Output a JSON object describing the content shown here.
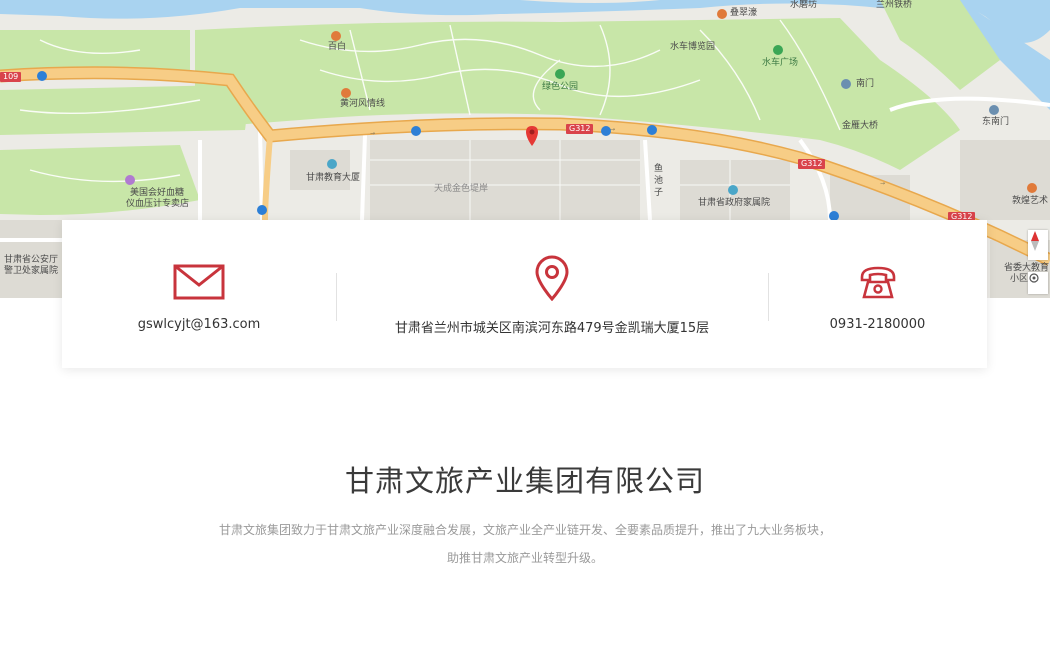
{
  "map": {
    "labels": {
      "dieci": "叠翠濠",
      "shuimo": "水磨坊",
      "lanzhou_bridge": "兰州铁桥",
      "baita": "百白",
      "shuiche_museum": "水车博览园",
      "shuiche_square": "水车广场",
      "lvse_park": "绿色公园",
      "nanmen": "南门",
      "huanghe_line": "黄河风情线",
      "jinyan_bridge": "金雁大桥",
      "dongnanmen": "东南门",
      "gansu_edu": "甘肃教育大厦",
      "tiancheng": "天成金色堤岸",
      "yu": "鱼",
      "chi": "池",
      "zi": "子",
      "gov_home": "甘肃省政府家属院",
      "dunhuang_art": "敦煌艺术",
      "meiguo_1": "美国会好血糖",
      "meiguo_2": "仪血压计专卖店",
      "gongan_1": "甘肃省公安厅",
      "gongan_2": "警卫处家属院",
      "gansu_jiaoke_1": "省委大教育",
      "gansu_jiaoke_2": "小区"
    },
    "roads": {
      "g312_a": "G312",
      "g312_b": "G312",
      "g312_c": "G312",
      "r109": "109"
    }
  },
  "contact": {
    "email": "gswlcyjt@163.com",
    "address": "甘肃省兰州市城关区南滨河东路479号金凯瑞大厦15层",
    "phone": "0931-2180000"
  },
  "company": {
    "name": "甘肃文旅产业集团有限公司",
    "desc_line1": "甘肃文旅集团致力于甘肃文旅产业深度融合发展，文旅产业全产业链开发、全要素品质提升，推出了九大业务板块，",
    "desc_line2": "助推甘肃文旅产业转型升级。"
  },
  "colors": {
    "accent": "#c8343c",
    "map_park": "#c8e6a8",
    "map_road": "#f5c77e",
    "map_river": "#a9d3f0"
  },
  "icons": {
    "email": "envelope-icon",
    "address": "location-pin-icon",
    "phone": "telephone-icon"
  }
}
